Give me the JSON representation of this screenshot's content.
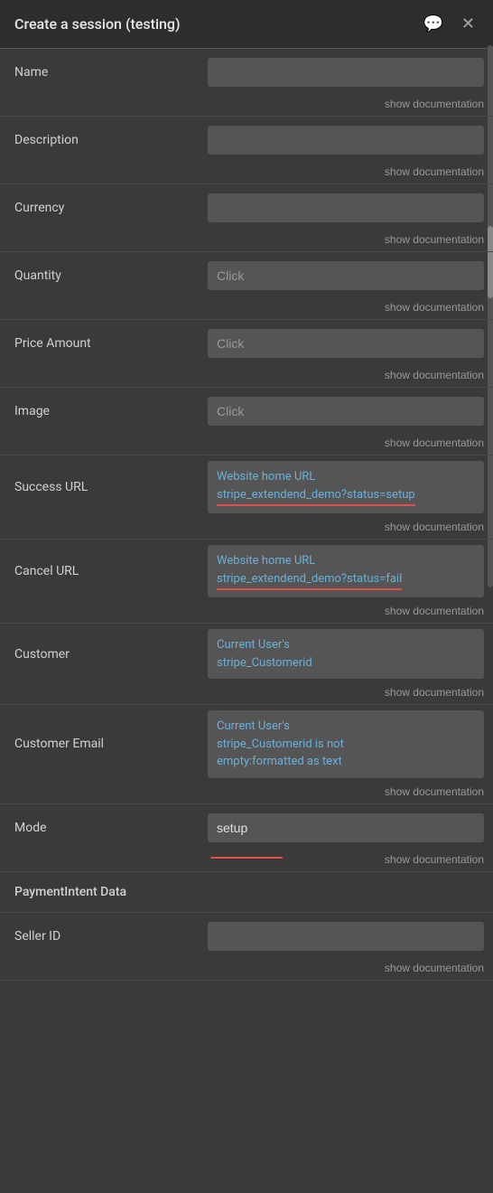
{
  "modal": {
    "title": "Create a session (testing)"
  },
  "header": {
    "comment_icon": "💬",
    "close_icon": "✕"
  },
  "fields": [
    {
      "id": "name",
      "label": "Name",
      "type": "text",
      "value": "",
      "placeholder": "",
      "show_doc": "show documentation"
    },
    {
      "id": "description",
      "label": "Description",
      "type": "text",
      "value": "",
      "placeholder": "",
      "show_doc": "show documentation"
    },
    {
      "id": "currency",
      "label": "Currency",
      "type": "text",
      "value": "",
      "placeholder": "",
      "show_doc": "show documentation"
    },
    {
      "id": "quantity",
      "label": "Quantity",
      "type": "click",
      "value": "Click",
      "show_doc": "show documentation"
    },
    {
      "id": "price_amount",
      "label": "Price Amount",
      "type": "click",
      "value": "Click",
      "show_doc": "show documentation"
    },
    {
      "id": "image",
      "label": "Image",
      "type": "click",
      "value": "Click",
      "show_doc": "show documentation"
    },
    {
      "id": "success_url",
      "label": "Success URL",
      "type": "complex",
      "value": "Website home URLstripe_extendend_demo?status=setup",
      "underline_text": "stripe_extendend_demo?status=setup",
      "prefix": "Website home URL",
      "show_doc": "show documentation",
      "has_underline": true
    },
    {
      "id": "cancel_url",
      "label": "Cancel URL",
      "type": "complex",
      "value": "Website home URLstripe_extendend_demo?status=fail",
      "prefix": "Website home URL",
      "underline_text": "stripe_extendend_demo?status=fail",
      "show_doc": "show documentation",
      "has_underline": true
    },
    {
      "id": "customer",
      "label": "Customer",
      "type": "complex",
      "value": "Current User's stripe_Customerid",
      "prefix": "",
      "underline_text": "",
      "show_doc": "show documentation",
      "has_underline": false
    },
    {
      "id": "customer_email",
      "label": "Customer Email",
      "type": "complex",
      "value": "Current User's stripe_Customerid is not empty:formatted as text",
      "prefix": "",
      "underline_text": "",
      "show_doc": "show documentation",
      "has_underline": false
    },
    {
      "id": "mode",
      "label": "Mode",
      "type": "mode",
      "value": "setup",
      "show_doc": "show documentation",
      "has_underline": true
    }
  ],
  "sections": [
    {
      "id": "paymentintent_data",
      "label": "PaymentIntent Data"
    }
  ],
  "extra_fields": [
    {
      "id": "seller_id",
      "label": "Seller ID",
      "type": "text",
      "value": "",
      "placeholder": "",
      "show_doc": "show documentation"
    }
  ],
  "labels": {
    "show_documentation": "show documentation"
  }
}
